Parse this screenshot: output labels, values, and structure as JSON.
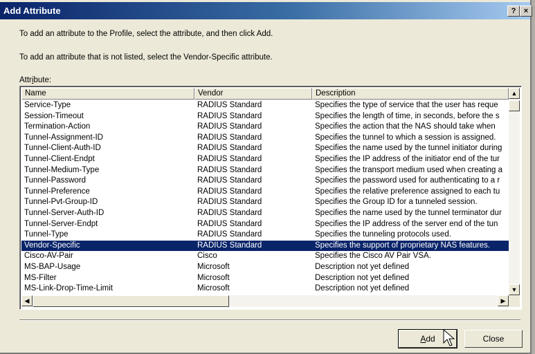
{
  "window": {
    "title": "Add Attribute",
    "help_label": "?",
    "close_label": "×"
  },
  "instructions": {
    "line1": "To add an attribute to the Profile, select the attribute, and then click Add.",
    "line2": "To add an attribute that is not listed, select the Vendor-Specific attribute."
  },
  "list": {
    "label_pre": "Attr",
    "label_u": "i",
    "label_post": "bute:",
    "columns": [
      "Name",
      "Vendor",
      "Description"
    ],
    "rows": [
      [
        "Service-Type",
        "RADIUS Standard",
        "Specifies the type of service that the user has reque"
      ],
      [
        "Session-Timeout",
        "RADIUS Standard",
        "Specifies the length of time, in seconds, before the s"
      ],
      [
        "Termination-Action",
        "RADIUS Standard",
        "Specifies the action that the NAS should take when"
      ],
      [
        "Tunnel-Assignment-ID",
        "RADIUS Standard",
        "Specifies the tunnel to which a session is assigned."
      ],
      [
        "Tunnel-Client-Auth-ID",
        "RADIUS Standard",
        "Specifies the name used by the tunnel initiator during"
      ],
      [
        "Tunnel-Client-Endpt",
        "RADIUS Standard",
        "Specifies the IP address of the initiator end of the tur"
      ],
      [
        "Tunnel-Medium-Type",
        "RADIUS Standard",
        "Specifies the transport medium used when creating a"
      ],
      [
        "Tunnel-Password",
        "RADIUS Standard",
        "Specifies the password used for authenticating to a r"
      ],
      [
        "Tunnel-Preference",
        "RADIUS Standard",
        "Specifies the relative preference assigned to each tu"
      ],
      [
        "Tunnel-Pvt-Group-ID",
        "RADIUS Standard",
        "Specifies the Group ID for a tunneled session."
      ],
      [
        "Tunnel-Server-Auth-ID",
        "RADIUS Standard",
        "Specifies the name used by the tunnel terminator dur"
      ],
      [
        "Tunnel-Server-Endpt",
        "RADIUS Standard",
        "Specifies the IP address of the server end of the tun"
      ],
      [
        "Tunnel-Type",
        "RADIUS Standard",
        "Specifies the tunneling protocols used."
      ],
      [
        "Vendor-Specific",
        "RADIUS Standard",
        "Specifies the support of proprietary NAS features."
      ],
      [
        "Cisco-AV-Pair",
        "Cisco",
        "Specifies the Cisco AV Pair VSA."
      ],
      [
        "MS-BAP-Usage",
        "Microsoft",
        "Description not yet defined"
      ],
      [
        "MS-Filter",
        "Microsoft",
        "Description not yet defined"
      ],
      [
        "MS-Link-Drop-Time-Limit",
        "Microsoft",
        "Description not yet defined"
      ]
    ],
    "selected_index": 13
  },
  "buttons": {
    "add_pre": "",
    "add_u": "A",
    "add_post": "dd",
    "close_label": "Close"
  },
  "icons": {
    "scroll_up": "up-arrow-icon",
    "scroll_down": "down-arrow-icon",
    "scroll_left": "left-arrow-icon",
    "scroll_right": "right-arrow-icon",
    "cursor": "mouse-pointer-icon"
  },
  "colors": {
    "selection": "#0a246a",
    "titlebar": "#0a246a"
  }
}
